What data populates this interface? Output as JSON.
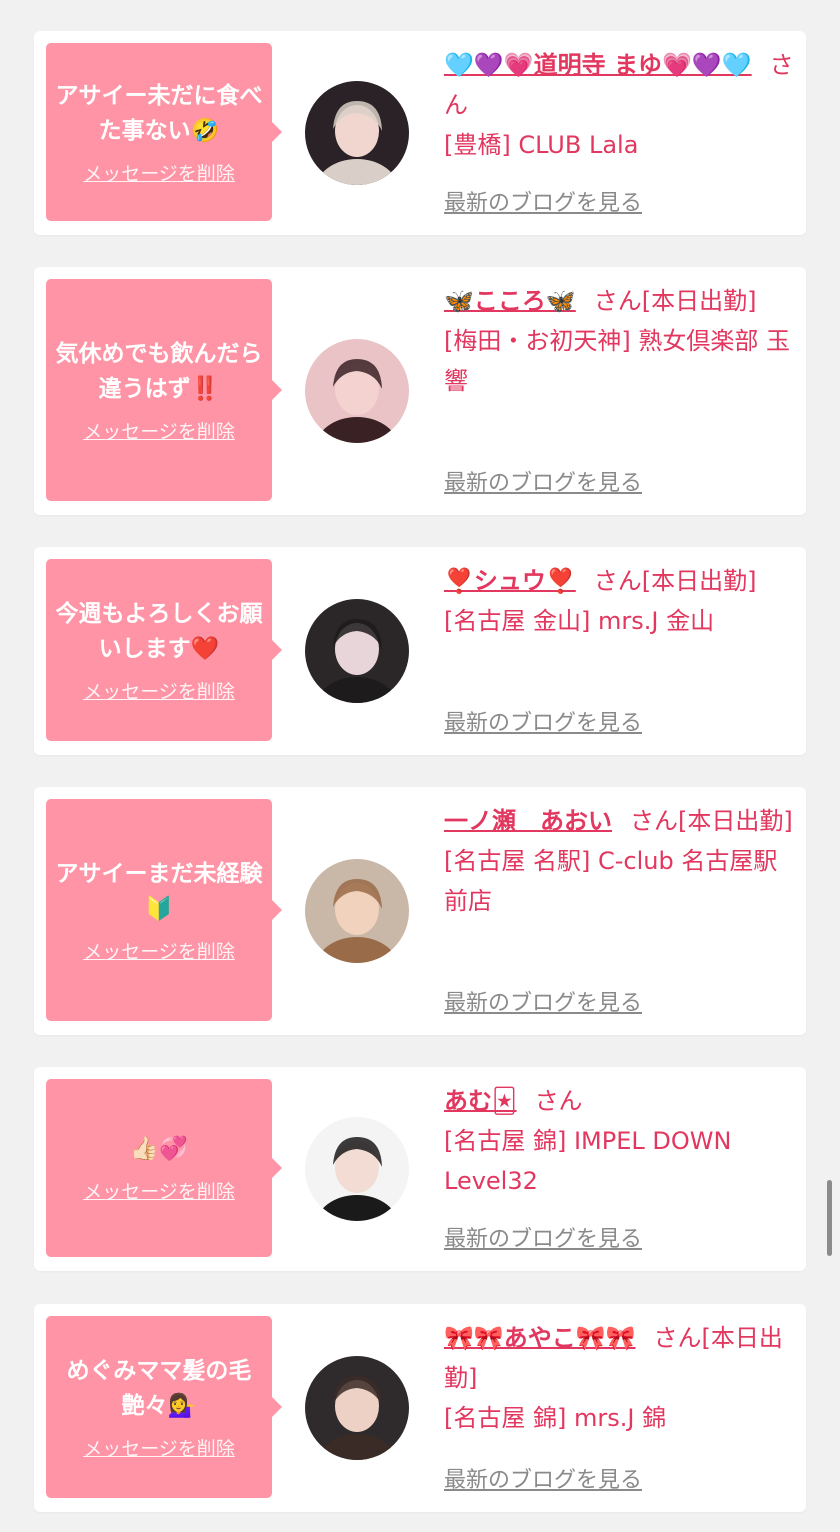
{
  "delete_label": "メッセージを削除",
  "blog_label": "最新のブログを見る",
  "colors": {
    "bubble": "#fe94a5",
    "accent_text": "#e2375f",
    "link_gray": "#8a8a8a",
    "background": "#f2f1f1"
  },
  "messages": [
    {
      "message": "アサイー未だに食べた事ない🤣",
      "name": "🩵💜💗道明寺 まゆ💗💜🩵",
      "suffix": "さん",
      "shop": "[豊橋] CLUB Lala"
    },
    {
      "message": "気休めでも飲んだら違うはず‼️",
      "name": "🦋こころ🦋",
      "suffix": "さん[本日出勤]",
      "shop": "[梅田・お初天神] 熟女倶楽部 玉響"
    },
    {
      "message": "今週もよろしくお願いします❤️",
      "name": "❣️シュウ❣️",
      "suffix": "さん[本日出勤]",
      "shop": "[名古屋 金山] mrs.J 金山"
    },
    {
      "message": "アサイーまだ未経験🔰",
      "name": "一ノ瀬　あおい",
      "suffix": "さん[本日出勤]",
      "shop": "[名古屋 名駅] C-club 名古屋駅前店"
    },
    {
      "message": "👍🏻💞",
      "name": "あむ🃏",
      "suffix": "さん",
      "shop": "[名古屋 錦] IMPEL DOWN Level32"
    },
    {
      "message": "めぐみママ髪の毛艶々💁‍♀️",
      "name": "🎀🎀あやこ🎀🎀",
      "suffix": "さん[本日出勤]",
      "shop": "[名古屋 錦] mrs.J 錦"
    }
  ]
}
